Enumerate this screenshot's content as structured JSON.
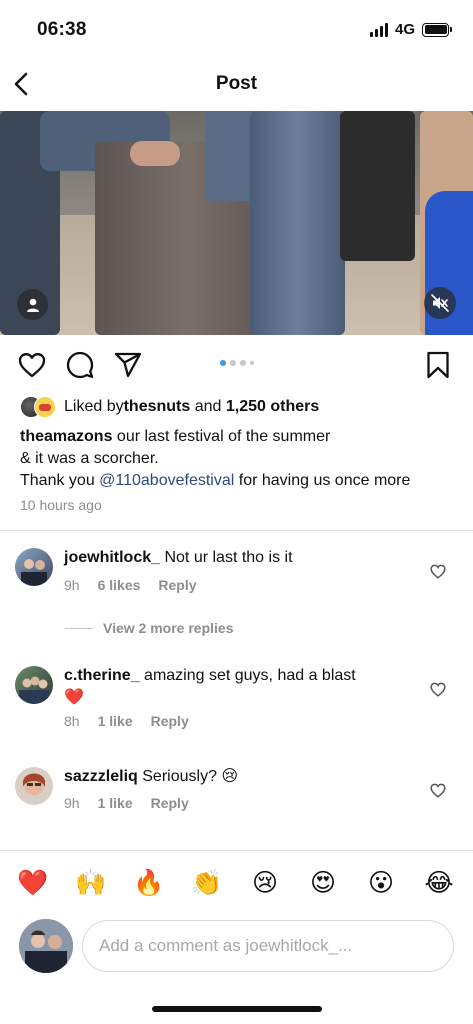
{
  "status_bar": {
    "time": "06:38",
    "network": "4G"
  },
  "header": {
    "title": "Post"
  },
  "icons": {
    "back": "chevron-left-icon",
    "user_tag": "user-icon",
    "mute": "speaker-muted-icon",
    "like": "heart-icon",
    "comment": "comment-bubble-icon",
    "share": "paper-plane-icon",
    "save": "bookmark-icon"
  },
  "carousel": {
    "total": 4,
    "current": 1
  },
  "likes": {
    "prefix": "Liked by ",
    "user": "thesnuts",
    "middle": " and ",
    "count": "1,250 others"
  },
  "caption": {
    "author": "theamazons",
    "line1": " our last festival of the summer",
    "line2": "& it was a scorcher.",
    "line3_prefix": "Thank you ",
    "mention": "@110abovefestival",
    "line3_suffix": " for having us once more"
  },
  "post_time": "10 hours ago",
  "comments": [
    {
      "user": "joewhitlock_",
      "text": " Not ur last tho is it",
      "time": "9h",
      "likes": "6 likes",
      "reply": "Reply"
    },
    {
      "user": "c.therine_",
      "text": " amazing set guys, had a blast",
      "emoji": "❤️",
      "time": "8h",
      "likes": "1 like",
      "reply": "Reply"
    },
    {
      "user": "sazzzleliq",
      "text": " Seriously? ",
      "emoji": "😢",
      "time": "9h",
      "likes": "1 like",
      "reply": "Reply"
    }
  ],
  "view_replies": "View 2 more replies",
  "emoji_bar": [
    "❤️",
    "🙌",
    "🔥",
    "👏",
    "😢",
    "😍",
    "😮",
    "😂"
  ],
  "composer": {
    "placeholder": "Add a comment as joewhitlock_..."
  },
  "colors": {
    "mention": "#2c4a7b",
    "meta": "#8e8e8e",
    "divider": "#e3e3e3"
  }
}
